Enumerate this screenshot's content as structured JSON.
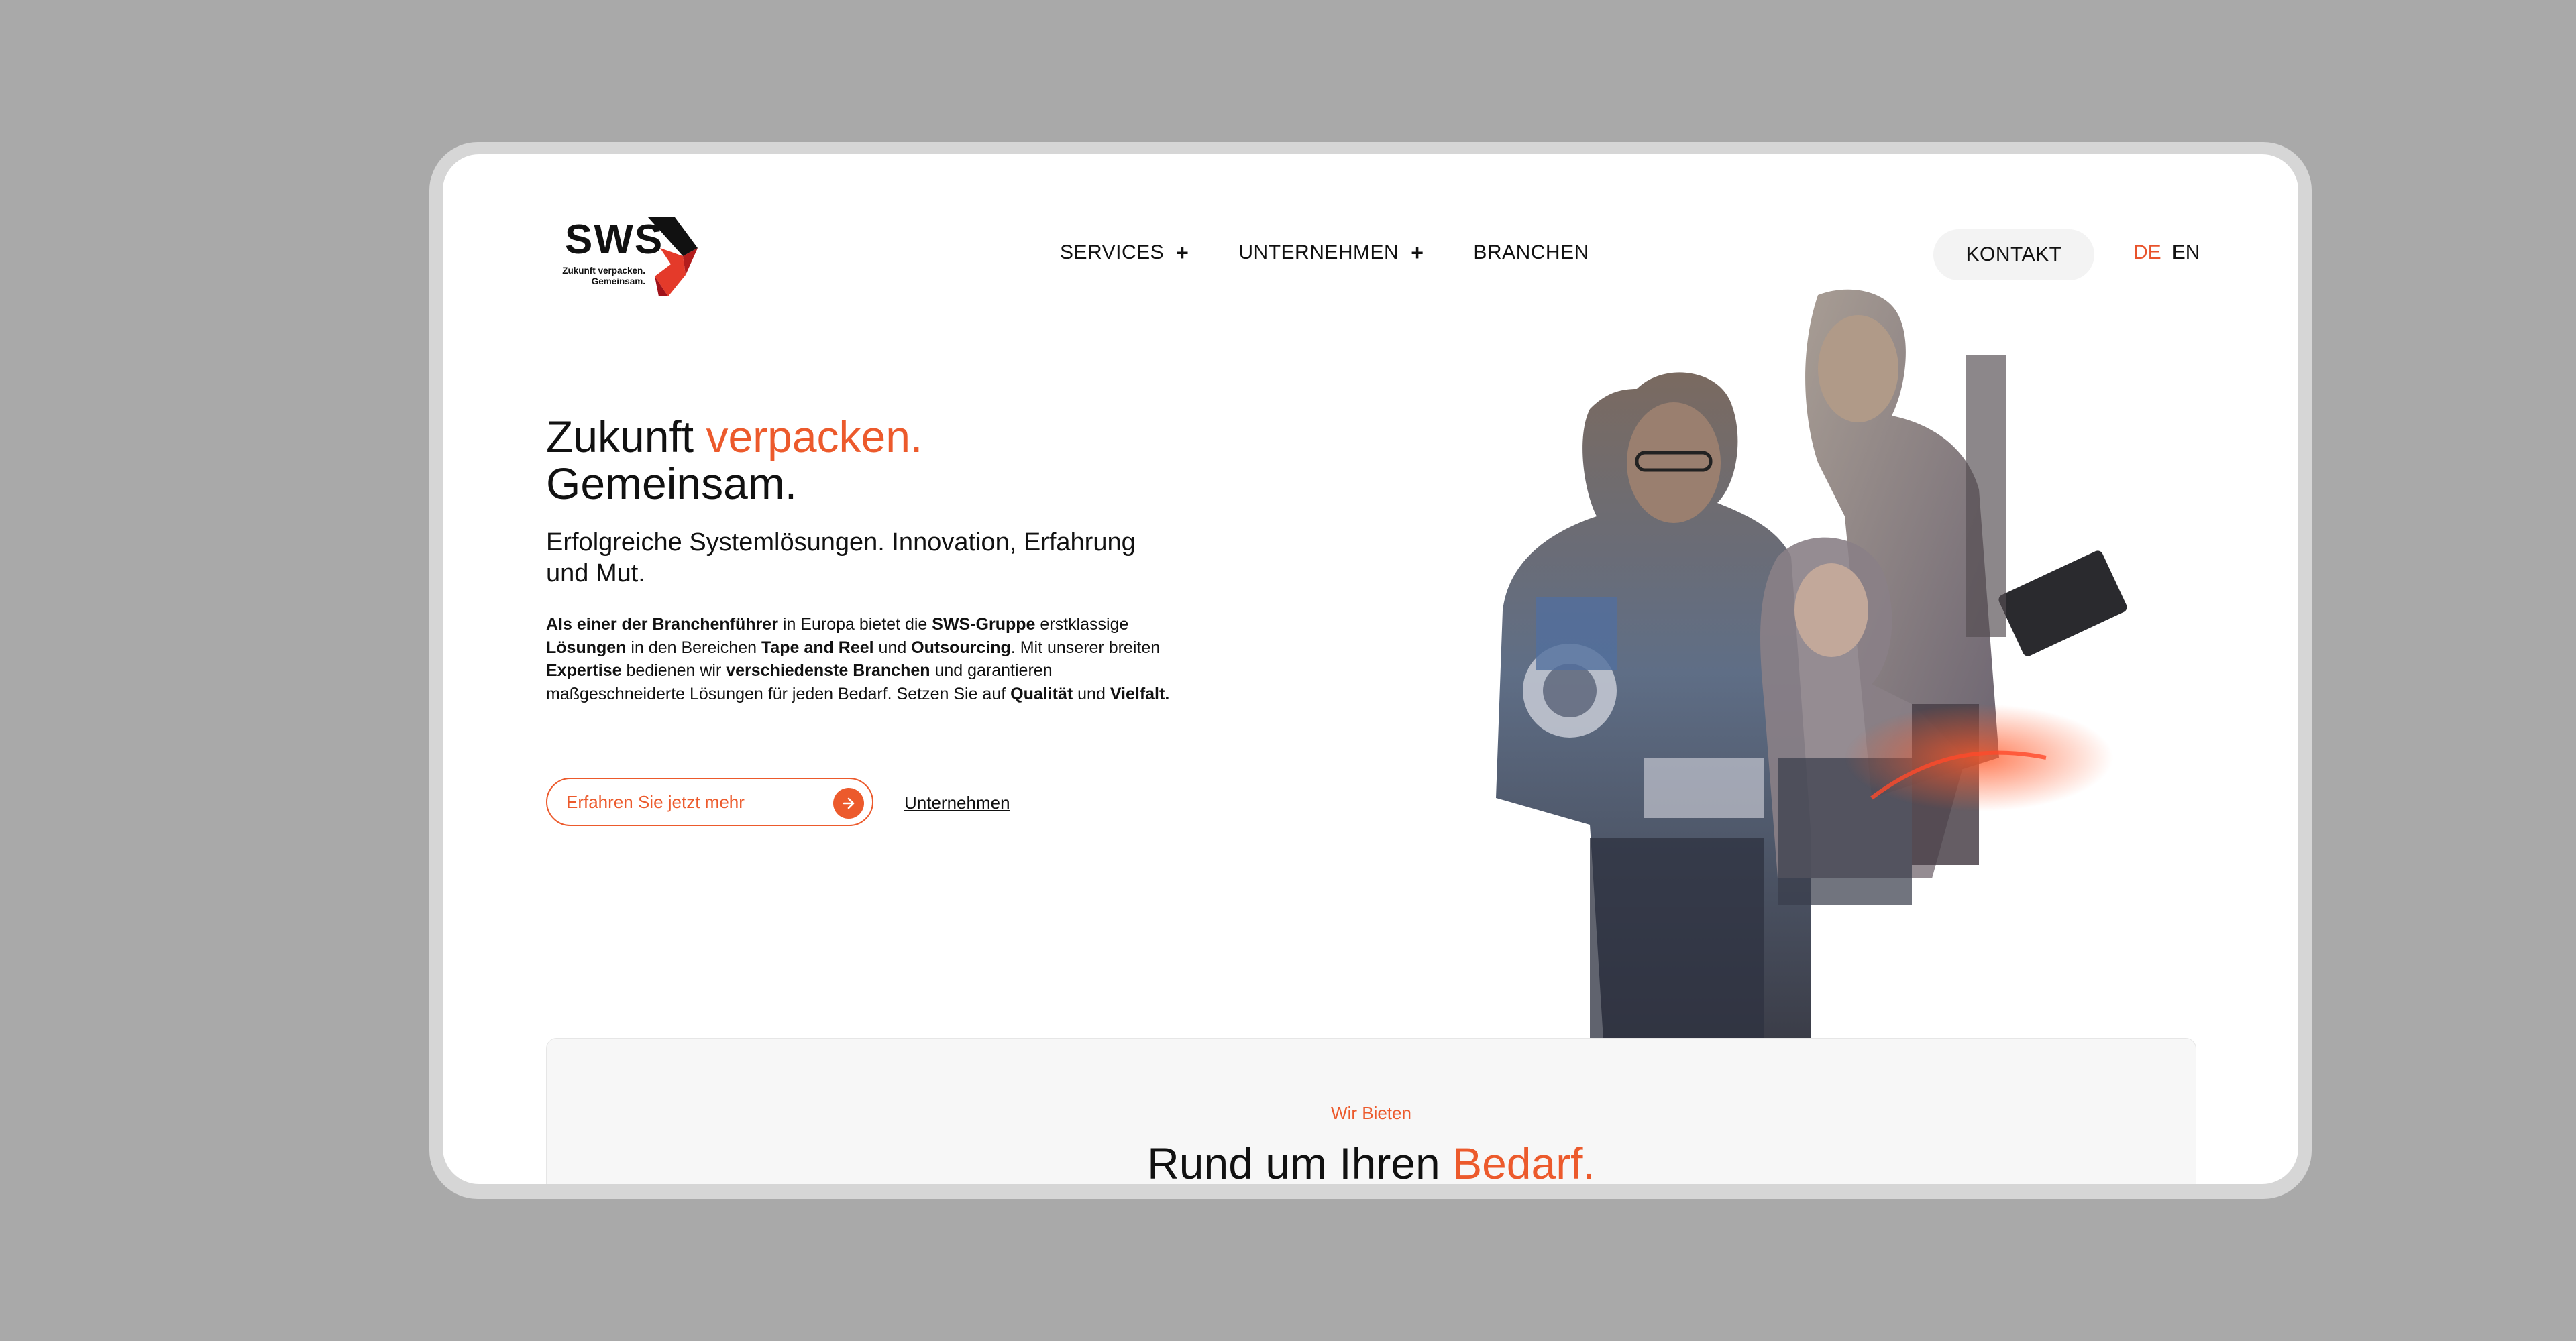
{
  "brand": {
    "wordmark": "SWS",
    "tagline_line1": "Zukunft verpacken.",
    "tagline_line2": "Gemeinsam.",
    "accent_color": "#ec5a2c",
    "dark_red": "#d72f24"
  },
  "nav": {
    "items": [
      {
        "label": "SERVICES",
        "expand": "+"
      },
      {
        "label": "UNTERNEHMEN",
        "expand": "+"
      },
      {
        "label": "BRANCHEN"
      }
    ],
    "contact_label": "KONTAKT",
    "lang_de": "DE",
    "lang_en": "EN"
  },
  "hero": {
    "title_part1": "Zukunft ",
    "title_accent": "verpacken.",
    "title_line2": "Gemeinsam.",
    "subtitle": "Erfolgreiche Systemlösungen. Innovation, Erfahrung und Mut.",
    "body": [
      {
        "t": "Als einer der Branchenführer",
        "b": true
      },
      {
        "t": " in Europa bietet die ",
        "b": false
      },
      {
        "t": "SWS-Gruppe",
        "b": true
      },
      {
        "t": " erstklassige ",
        "b": false
      },
      {
        "t": "Lösungen",
        "b": true
      },
      {
        "t": " in den Bereichen ",
        "b": false
      },
      {
        "t": "Tape and Reel",
        "b": true
      },
      {
        "t": " und ",
        "b": false
      },
      {
        "t": "Outsourcing",
        "b": true
      },
      {
        "t": ". Mit unserer breiten ",
        "b": false
      },
      {
        "t": "Expertise",
        "b": true
      },
      {
        "t": " bedienen wir ",
        "b": false
      },
      {
        "t": "verschiedenste Branchen",
        "b": true
      },
      {
        "t": " und garantieren maßgeschneiderte Lösungen für jeden Bedarf. Setzen Sie auf ",
        "b": false
      },
      {
        "t": "Qualität",
        "b": true
      },
      {
        "t": " und ",
        "b": false
      },
      {
        "t": "Vielfalt.",
        "b": true
      }
    ],
    "cta_label": "Erfahren Sie jetzt mehr",
    "cta_icon": "arrow-right-icon",
    "secondary_link": "Unternehmen"
  },
  "offer": {
    "kicker": "Wir Bieten",
    "title_part1": "Rund um Ihren ",
    "title_accent": "Bedarf."
  }
}
